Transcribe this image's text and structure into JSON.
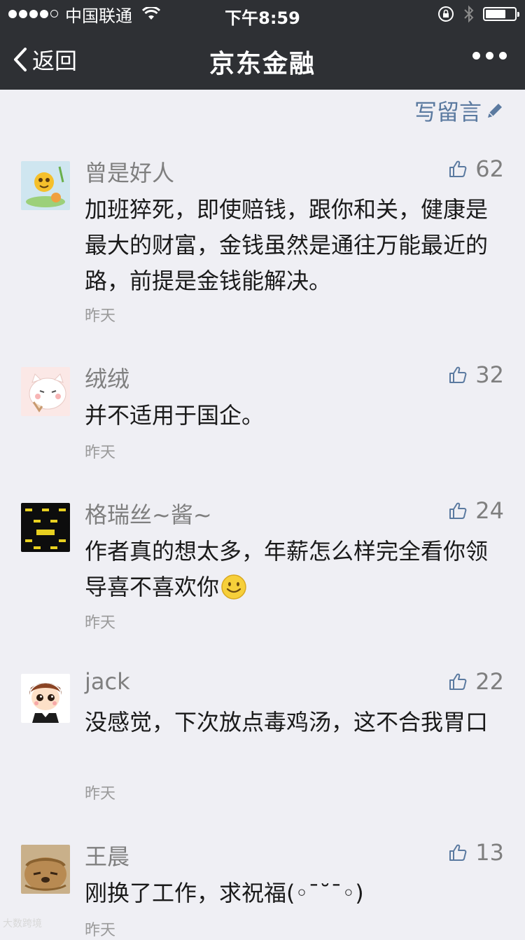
{
  "status_bar": {
    "carrier": "中国联通",
    "time": "下午8:59"
  },
  "nav": {
    "back_label": "返回",
    "title": "京东金融"
  },
  "write_comment_label": "写留言",
  "comments": [
    {
      "name": "曾是好人",
      "likes": "62",
      "text": "加班猝死，即使赔钱，跟你和关，健康是最大的财富，金钱虽然是通往万能最近的路，前提是金钱能解决。",
      "time": "昨天"
    },
    {
      "name": "绒绒",
      "likes": "32",
      "text": "并不适用于国企。",
      "time": "昨天"
    },
    {
      "name": "格瑞丝~酱~",
      "likes": "24",
      "text": "作者真的想太多，年薪怎么样完全看你领导喜不喜欢你",
      "time": "昨天"
    },
    {
      "name": "jack",
      "likes": "22",
      "text": "没感觉，下次放点毒鸡汤，这不合我胃口",
      "time": "昨天"
    },
    {
      "name": "王晨",
      "likes": "13",
      "text": "刚换了工作，求祝福(◦¯˘¯◦)",
      "time": "昨天"
    }
  ],
  "watermark": "大数跨境"
}
